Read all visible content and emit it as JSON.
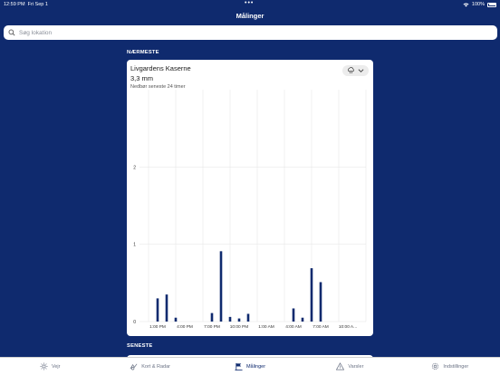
{
  "status": {
    "time": "12:59 PM",
    "date": "Fri Sep 1",
    "battery": "100%"
  },
  "header": {
    "title": "Målinger"
  },
  "search": {
    "placeholder": "Søg lokation"
  },
  "sections": {
    "nearest": "NÆRMESTE",
    "recent": "SENESTE"
  },
  "station": {
    "name": "Livgardens Kaserne",
    "value": "3,3 mm",
    "subtitle": "Nedbør seneste 24 timer"
  },
  "chart_data": {
    "type": "bar",
    "x_tick_labels": [
      "1:00 PM",
      "4:00 PM",
      "7:00 PM",
      "10:00 PM",
      "1:00 AM",
      "4:00 AM",
      "7:00 AM",
      "10:00 A..."
    ],
    "y_tick_labels": [
      "0",
      "1",
      "2"
    ],
    "ylim": [
      0,
      3
    ],
    "grid": true,
    "bar_hours": [
      0,
      1,
      2,
      6,
      7,
      8,
      9,
      10,
      15,
      16,
      17,
      18
    ],
    "values": [
      0.3,
      0.35,
      0.05,
      0.11,
      0.91,
      0.06,
      0.04,
      0.1,
      0.17,
      0.05,
      0.69,
      0.51
    ],
    "hours_span": 24
  },
  "tabs": [
    {
      "label": "Vejr",
      "icon": "sun-icon",
      "active": false
    },
    {
      "label": "Kort & Radar",
      "icon": "map-icon",
      "active": false
    },
    {
      "label": "Målinger",
      "icon": "flag-icon",
      "active": true
    },
    {
      "label": "Varsler",
      "icon": "warning-icon",
      "active": false
    },
    {
      "label": "Indstillinger",
      "icon": "gear-icon",
      "active": false
    }
  ],
  "colors": {
    "brand": "#0f2a6e",
    "bar": "#0f2a6e",
    "grid": "#e3e3e3"
  }
}
